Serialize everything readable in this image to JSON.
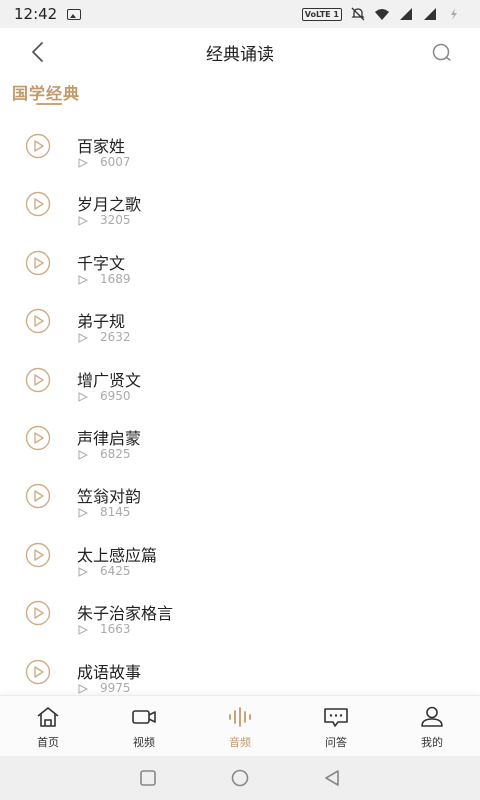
{
  "status_bar": {
    "time": "12:42",
    "volte": "VoLTE 1"
  },
  "header": {
    "title": "经典诵读",
    "back_icon": "chevron-left-icon",
    "search_icon": "search-icon"
  },
  "section": {
    "title": "国学经典"
  },
  "colors": {
    "accent": "#c29a6a",
    "text": "#222222",
    "muted": "#aaaaaa"
  },
  "items": [
    {
      "title": "百家姓",
      "count": "6007"
    },
    {
      "title": "岁月之歌",
      "count": "3205"
    },
    {
      "title": "千字文",
      "count": "1689"
    },
    {
      "title": "弟子规",
      "count": "2632"
    },
    {
      "title": "增广贤文",
      "count": "6950"
    },
    {
      "title": "声律启蒙",
      "count": "6825"
    },
    {
      "title": "笠翁对韵",
      "count": "8145"
    },
    {
      "title": "太上感应篇",
      "count": "6425"
    },
    {
      "title": "朱子治家格言",
      "count": "1663"
    },
    {
      "title": "成语故事",
      "count": "9975"
    }
  ],
  "tabbar": {
    "home": "首页",
    "video": "视频",
    "audio": "音频",
    "qa": "问答",
    "mine": "我的",
    "active": "audio"
  }
}
